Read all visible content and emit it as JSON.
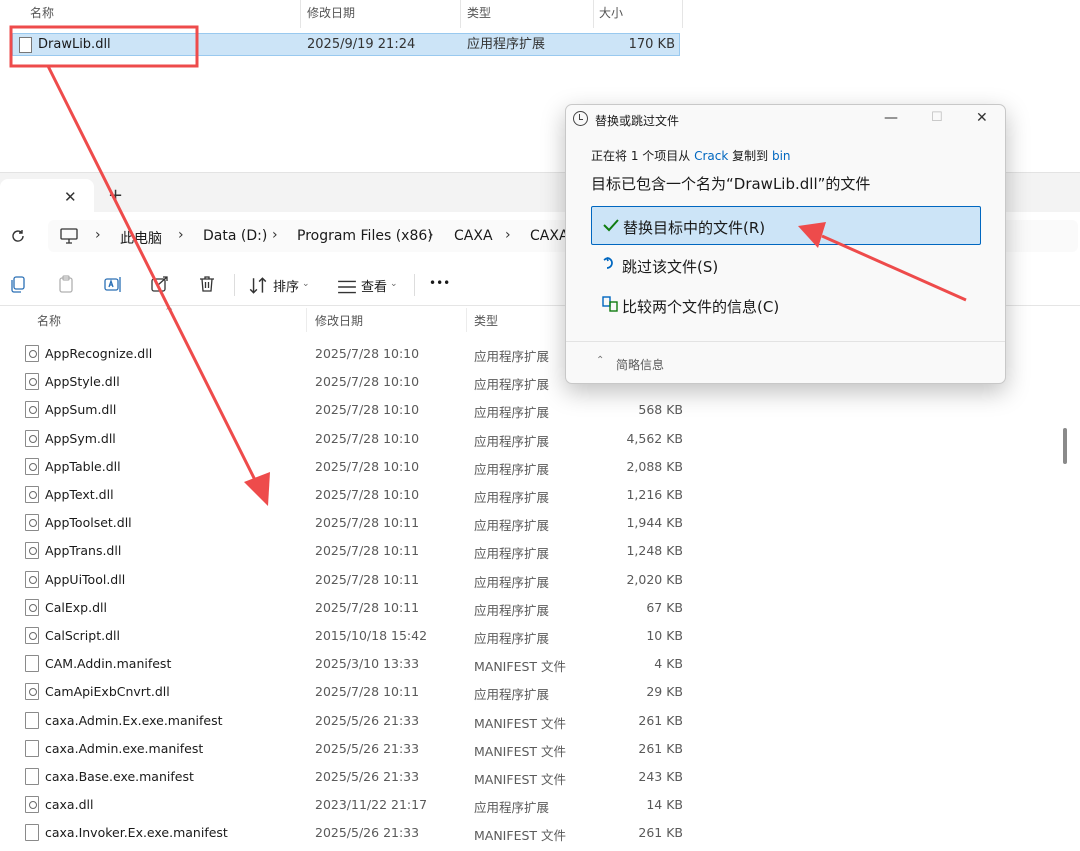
{
  "source_explorer": {
    "columns": {
      "name": "名称",
      "modified": "修改日期",
      "type": "类型",
      "size": "大小"
    },
    "file": {
      "name": "DrawLib.dll",
      "modified": "2025/9/19 21:24",
      "type": "应用程序扩展",
      "size": "170 KB"
    }
  },
  "dest_explorer": {
    "tab": {
      "close": "✕",
      "add": "+"
    },
    "breadcrumb": [
      "此电脑",
      "Data (D:)",
      "Program Files (x86)",
      "CAXA",
      "CAXA"
    ],
    "toolbar": {
      "sort_label": "排序",
      "view_label": "查看",
      "more": "•••"
    },
    "columns": {
      "name": "名称",
      "modified": "修改日期",
      "type": "类型"
    },
    "files": [
      {
        "name": "AppRecognize.dll",
        "modified": "2025/7/28 10:10",
        "type": "应用程序扩展",
        "size": "",
        "icon": "dll-file-icon"
      },
      {
        "name": "AppStyle.dll",
        "modified": "2025/7/28 10:10",
        "type": "应用程序扩展",
        "size": "",
        "icon": "dll-file-icon"
      },
      {
        "name": "AppSum.dll",
        "modified": "2025/7/28 10:10",
        "type": "应用程序扩展",
        "size": "568 KB",
        "icon": "dll-file-icon"
      },
      {
        "name": "AppSym.dll",
        "modified": "2025/7/28 10:10",
        "type": "应用程序扩展",
        "size": "4,562 KB",
        "icon": "dll-file-icon"
      },
      {
        "name": "AppTable.dll",
        "modified": "2025/7/28 10:10",
        "type": "应用程序扩展",
        "size": "2,088 KB",
        "icon": "dll-file-icon"
      },
      {
        "name": "AppText.dll",
        "modified": "2025/7/28 10:10",
        "type": "应用程序扩展",
        "size": "1,216 KB",
        "icon": "dll-file-icon"
      },
      {
        "name": "AppToolset.dll",
        "modified": "2025/7/28 10:11",
        "type": "应用程序扩展",
        "size": "1,944 KB",
        "icon": "dll-file-icon"
      },
      {
        "name": "AppTrans.dll",
        "modified": "2025/7/28 10:11",
        "type": "应用程序扩展",
        "size": "1,248 KB",
        "icon": "dll-file-icon"
      },
      {
        "name": "AppUiTool.dll",
        "modified": "2025/7/28 10:11",
        "type": "应用程序扩展",
        "size": "2,020 KB",
        "icon": "dll-file-icon"
      },
      {
        "name": "CalExp.dll",
        "modified": "2025/7/28 10:11",
        "type": "应用程序扩展",
        "size": "67 KB",
        "icon": "dll-file-icon"
      },
      {
        "name": "CalScript.dll",
        "modified": "2015/10/18 15:42",
        "type": "应用程序扩展",
        "size": "10 KB",
        "icon": "dll-file-icon"
      },
      {
        "name": "CAM.Addin.manifest",
        "modified": "2025/3/10 13:33",
        "type": "MANIFEST 文件",
        "size": "4 KB",
        "icon": "manifest-file-icon"
      },
      {
        "name": "CamApiExbCnvrt.dll",
        "modified": "2025/7/28 10:11",
        "type": "应用程序扩展",
        "size": "29 KB",
        "icon": "dll-file-icon"
      },
      {
        "name": "caxa.Admin.Ex.exe.manifest",
        "modified": "2025/5/26 21:33",
        "type": "MANIFEST 文件",
        "size": "261 KB",
        "icon": "manifest-file-icon"
      },
      {
        "name": "caxa.Admin.exe.manifest",
        "modified": "2025/5/26 21:33",
        "type": "MANIFEST 文件",
        "size": "261 KB",
        "icon": "manifest-file-icon"
      },
      {
        "name": "caxa.Base.exe.manifest",
        "modified": "2025/5/26 21:33",
        "type": "MANIFEST 文件",
        "size": "243 KB",
        "icon": "manifest-file-icon"
      },
      {
        "name": "caxa.dll",
        "modified": "2023/11/22 21:17",
        "type": "应用程序扩展",
        "size": "14 KB",
        "icon": "dll-file-icon"
      },
      {
        "name": "caxa.Invoker.Ex.exe.manifest",
        "modified": "2025/5/26 21:33",
        "type": "MANIFEST 文件",
        "size": "261 KB",
        "icon": "manifest-file-icon"
      }
    ]
  },
  "dialog": {
    "title": "替换或跳过文件",
    "status_prefix": "正在将 1 个项目从 ",
    "source_folder": "Crack",
    "status_mid": " 复制到 ",
    "dest_folder": "bin",
    "heading": "目标已包含一个名为“DrawLib.dll”的文件",
    "options": {
      "replace": "替换目标中的文件(R)",
      "skip": "跳过该文件(S)",
      "compare": "比较两个文件的信息(C)"
    },
    "more_info": "简略信息"
  },
  "colors": {
    "annotation": "#ee4b4b",
    "selection": "#cce4f7",
    "accent": "#0067c0"
  }
}
